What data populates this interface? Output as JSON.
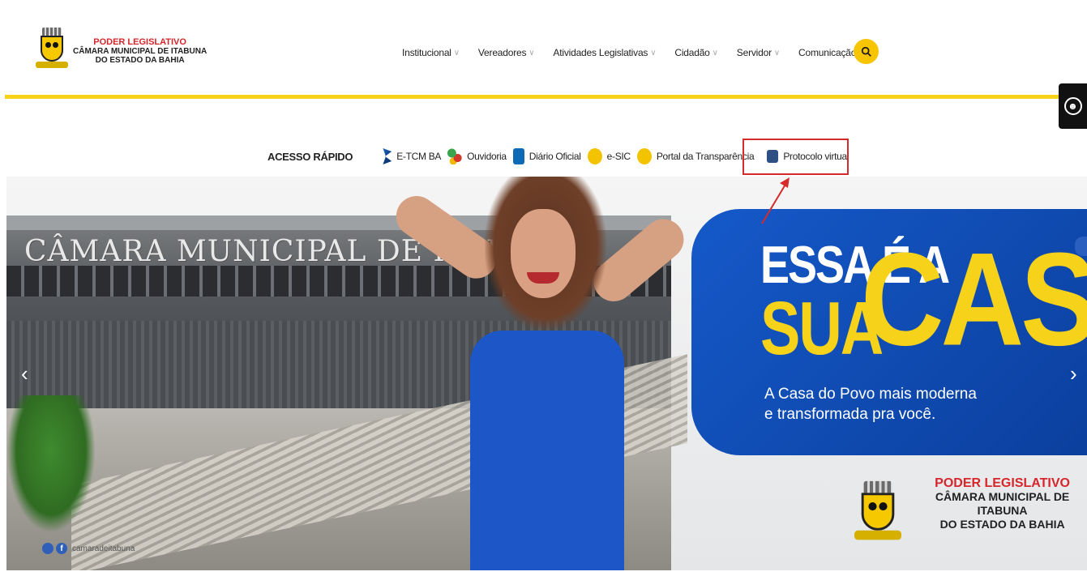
{
  "logo": {
    "line1": "PODER LEGISLATIVO",
    "line2": "CÂMARA MUNICIPAL DE ITABUNA",
    "line3": "DO ESTADO DA BAHIA"
  },
  "nav": {
    "items": [
      {
        "label": "Institucional"
      },
      {
        "label": "Vereadores"
      },
      {
        "label": "Atividades Legislativas"
      },
      {
        "label": "Cidadão"
      },
      {
        "label": "Servidor"
      },
      {
        "label": "Comunicação"
      }
    ],
    "search_icon": "search-icon"
  },
  "quick_access": {
    "title": "ACESSO RÁPIDO",
    "items": [
      {
        "label": "E-TCM BA",
        "icon": "etcm-icon"
      },
      {
        "label": "Ouvidoria",
        "icon": "ouvidoria-icon"
      },
      {
        "label": "Diário Oficial",
        "icon": "diario-icon"
      },
      {
        "label": "e-SIC",
        "icon": "info-icon"
      },
      {
        "label": "Portal da Transparência",
        "icon": "magnifier-icon"
      },
      {
        "label": "Protocolo virtual",
        "icon": "protocolo-icon"
      }
    ]
  },
  "banner": {
    "building_title": "CÂMARA MUNICIPAL DE ITABUNA",
    "slogan_line1": "ESSA É A",
    "slogan_line2": "SUA",
    "slogan_big": "CASA!",
    "tagline_line1": "A Casa do Povo mais moderna",
    "tagline_line2": "e transformada pra você.",
    "social_handle": "camaradeitabuna",
    "logo_line1": "PODER LEGISLATIVO",
    "logo_line2": "CÂMARA MUNICIPAL DE ITABUNA",
    "logo_line3": "DO ESTADO DA BAHIA"
  },
  "colors": {
    "accent_yellow": "#f6d21a",
    "brand_blue": "#1559c9",
    "highlight_red": "#d62b2b"
  }
}
